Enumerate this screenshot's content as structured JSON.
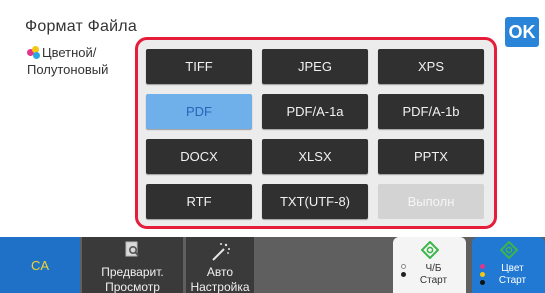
{
  "header": {
    "title": "Формат Файла",
    "ok_label": "OK"
  },
  "color_mode": {
    "line1": "Цветной/",
    "line2": "Полутоновый"
  },
  "format_buttons": [
    {
      "label": "TIFF",
      "state": "normal"
    },
    {
      "label": "JPEG",
      "state": "normal"
    },
    {
      "label": "XPS",
      "state": "normal"
    },
    {
      "label": "PDF",
      "state": "selected"
    },
    {
      "label": "PDF/A-1a",
      "state": "normal"
    },
    {
      "label": "PDF/A-1b",
      "state": "normal"
    },
    {
      "label": "DOCX",
      "state": "normal"
    },
    {
      "label": "XLSX",
      "state": "normal"
    },
    {
      "label": "PPTX",
      "state": "normal"
    },
    {
      "label": "RTF",
      "state": "normal"
    },
    {
      "label": "TXT(UTF-8)",
      "state": "normal"
    },
    {
      "label": "Выполн",
      "state": "disabled"
    }
  ],
  "bottom_bar": {
    "ca_label": "CA",
    "preview_line1": "Предварит.",
    "preview_line2": "Просмотр",
    "auto_line1": "Авто",
    "auto_line2": "Настройка",
    "bw_start_line1": "Ч/Б",
    "bw_start_line2": "Старт",
    "color_start_line1": "Цвет",
    "color_start_line2": "Старт"
  },
  "colors": {
    "accent_blue": "#2179d4",
    "panel_border_red": "#e51c3a",
    "selected_button": "#6fb0ea",
    "ca_text_yellow": "#f2d52b",
    "start_icon_green": "#3cb54a"
  },
  "icons": {
    "preview": "magnifier-page-icon",
    "auto": "magic-wand-icon",
    "start": "diamond-start-icon"
  }
}
